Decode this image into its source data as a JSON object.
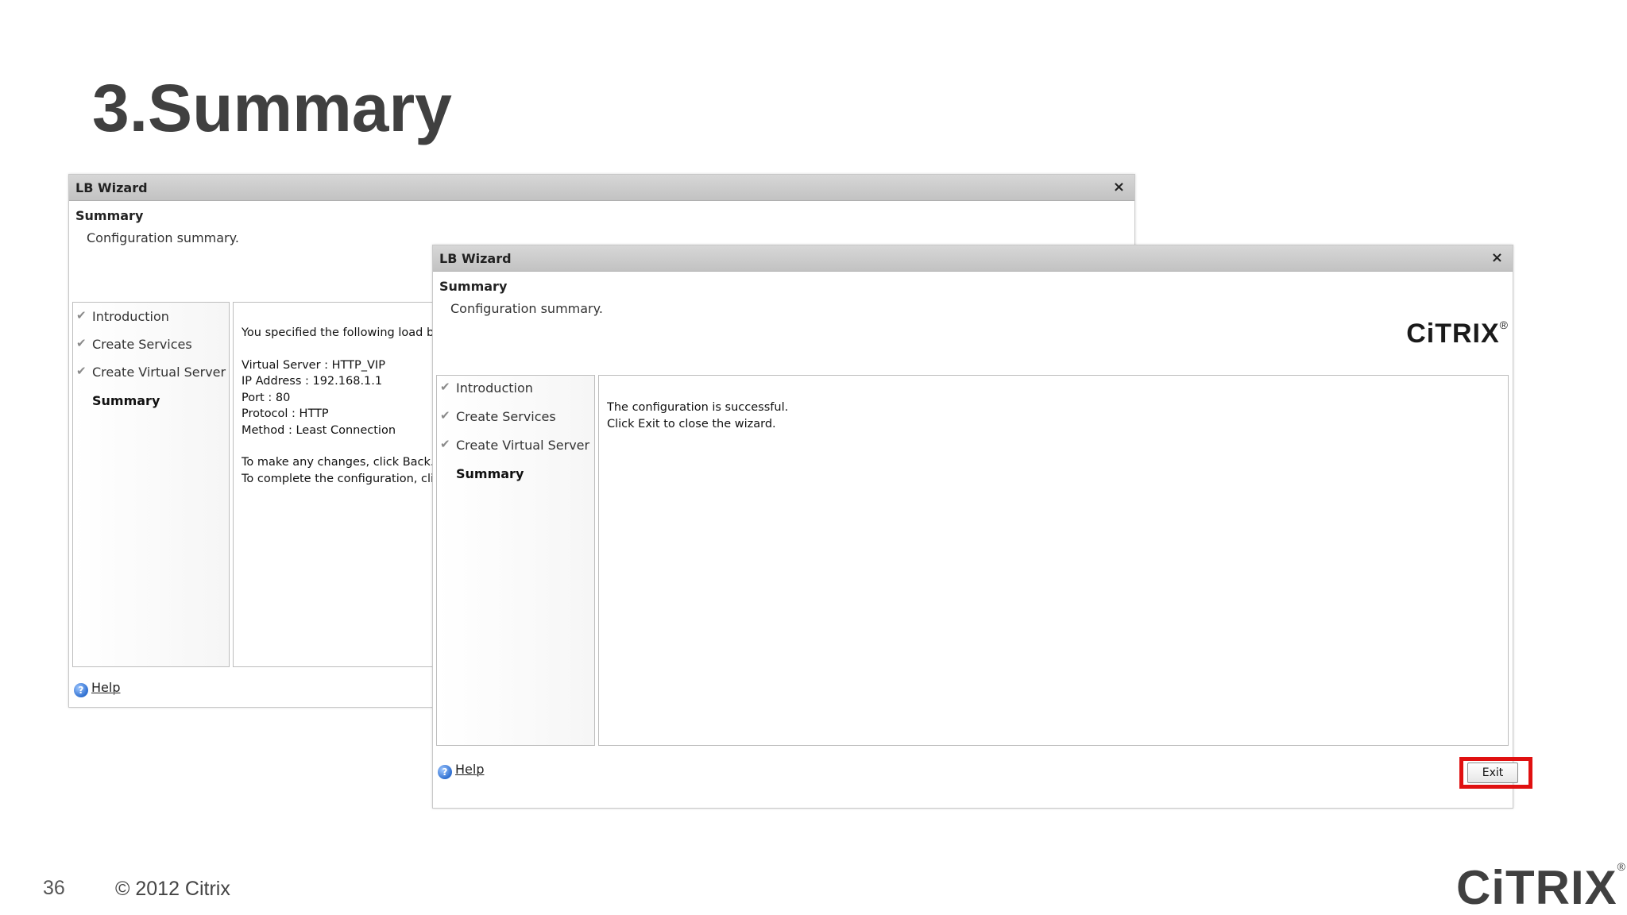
{
  "slide": {
    "title": "3.Summary",
    "page_number": "36",
    "copyright": "© 2012 Citrix",
    "logo": "CiTRIX",
    "logo_mark": "®"
  },
  "window_back": {
    "title": "LB Wizard",
    "close_glyph": "×",
    "header_title": "Summary",
    "header_subtitle": "Configuration summary.",
    "steps": [
      {
        "label": "Introduction",
        "done": true
      },
      {
        "label": "Create Services",
        "done": true
      },
      {
        "label": "Create Virtual Server",
        "done": true
      },
      {
        "label": "Summary",
        "done": false
      }
    ],
    "content": {
      "intro": "You specified the following load ba",
      "virtual_server": "Virtual Server : HTTP_VIP",
      "ip_address": "IP Address : 192.168.1.1",
      "port": "Port : 80",
      "protocol": "Protocol : HTTP",
      "method": "Method : Least Connection",
      "changes": "To make any changes, click Back.",
      "complete": "To complete the configuration, clic"
    },
    "help_label": "Help",
    "help_glyph": "?"
  },
  "window_front": {
    "title": "LB Wizard",
    "close_glyph": "×",
    "header_title": "Summary",
    "header_subtitle": "Configuration summary.",
    "logo": "CiTRIX",
    "logo_mark": "®",
    "steps": [
      {
        "label": "Introduction",
        "done": true
      },
      {
        "label": "Create Services",
        "done": true
      },
      {
        "label": "Create Virtual Server",
        "done": true
      },
      {
        "label": "Summary",
        "done": false
      }
    ],
    "content": {
      "success": "The configuration is successful.",
      "exit_hint": "Click Exit to close the wizard."
    },
    "help_label": "Help",
    "help_glyph": "?",
    "exit_label": "Exit"
  },
  "icons": {
    "check": "✔",
    "help": "help-icon",
    "close": "close-icon"
  },
  "colors": {
    "title_text": "#404040",
    "highlight": "#e01010",
    "titlebar": "#c8c8c8"
  }
}
